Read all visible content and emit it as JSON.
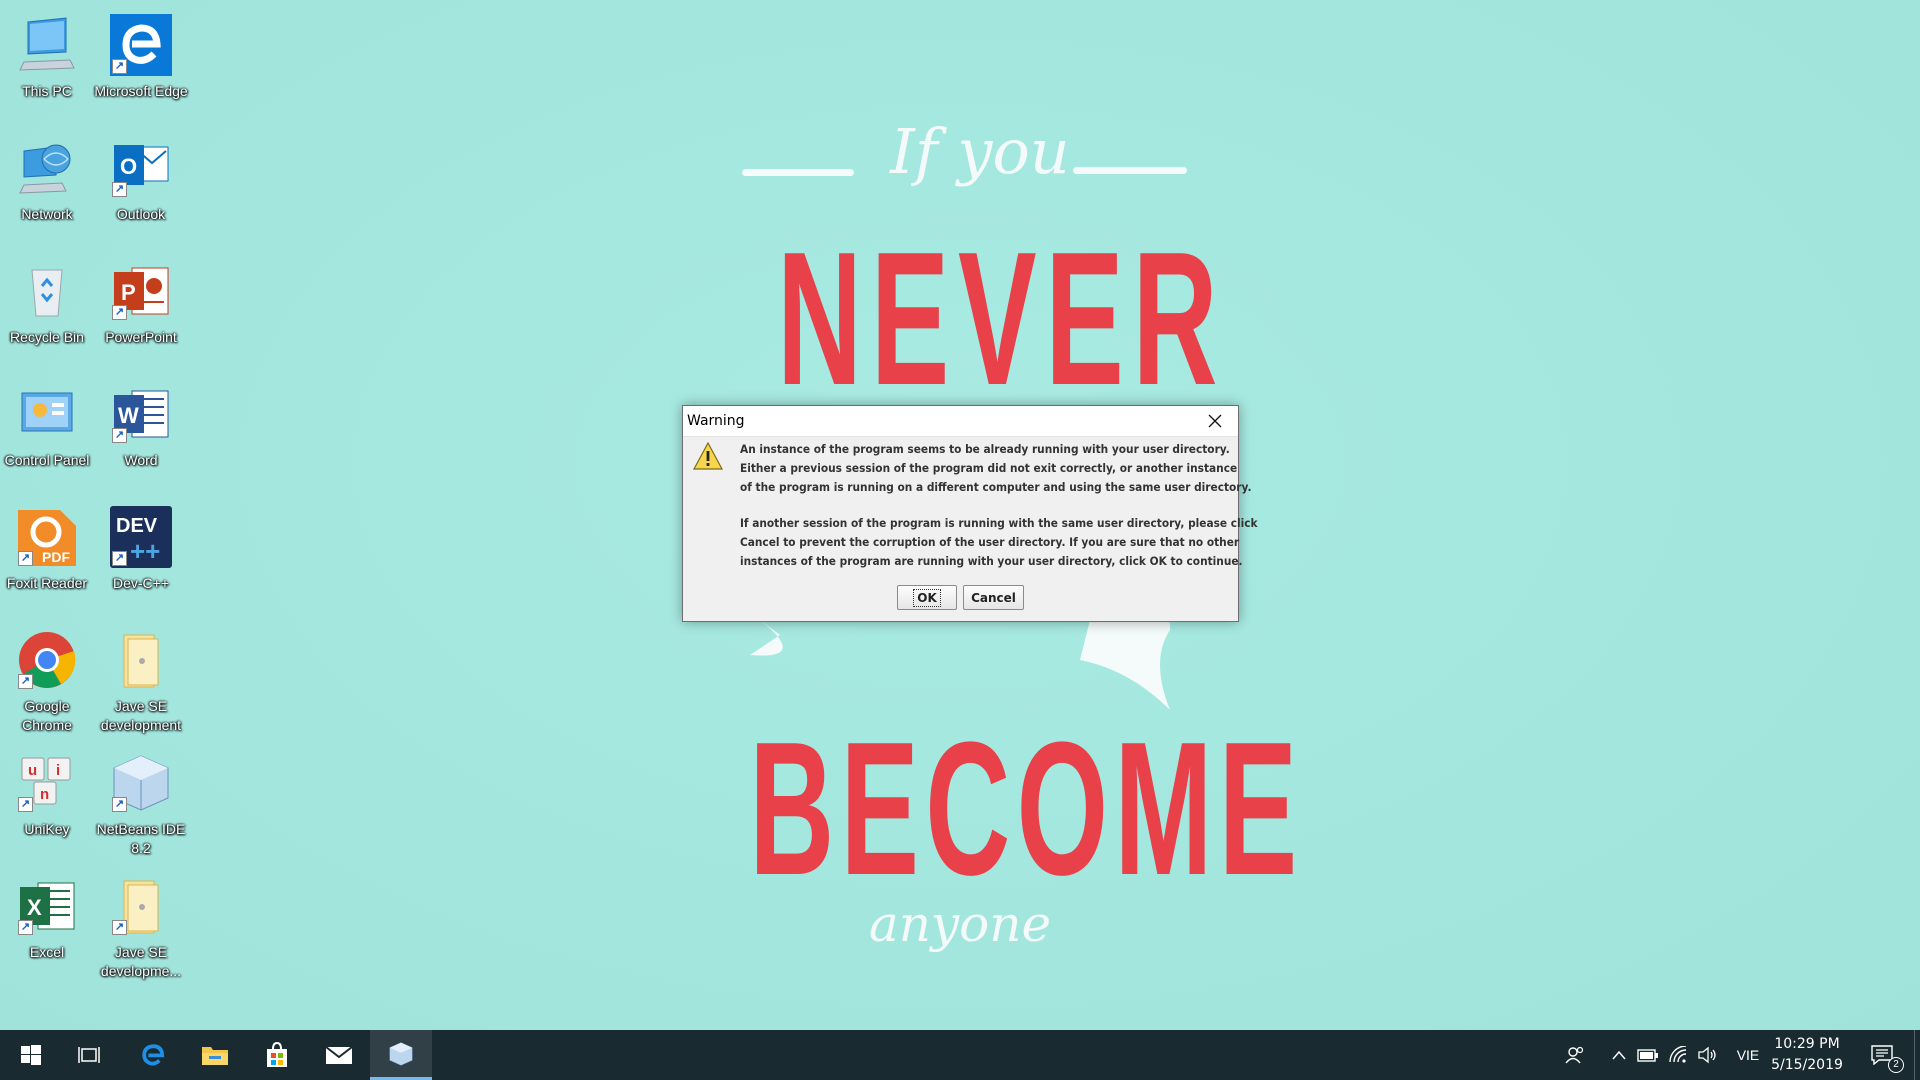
{
  "desktop": {
    "icons": [
      {
        "label": "This PC",
        "icon": "this-pc-icon"
      },
      {
        "label": "Microsoft Edge",
        "icon": "edge-icon"
      },
      {
        "label": "Network",
        "icon": "network-icon"
      },
      {
        "label": "Outlook",
        "icon": "outlook-icon"
      },
      {
        "label": "Recycle Bin",
        "icon": "recycle-bin-icon"
      },
      {
        "label": "PowerPoint",
        "icon": "powerpoint-icon"
      },
      {
        "label": "Control Panel",
        "icon": "control-panel-icon"
      },
      {
        "label": "Word",
        "icon": "word-icon"
      },
      {
        "label": "Foxit Reader",
        "icon": "foxit-reader-icon"
      },
      {
        "label": "Dev-C++",
        "icon": "dev-cpp-icon"
      },
      {
        "label": "Google Chrome",
        "icon": "chrome-icon"
      },
      {
        "label": "Jave SE development",
        "icon": "folder-icon"
      },
      {
        "label": "UniKey",
        "icon": "unikey-icon"
      },
      {
        "label": "NetBeans IDE 8.2",
        "icon": "netbeans-icon"
      },
      {
        "label": "Excel",
        "icon": "excel-icon"
      },
      {
        "label": "Jave SE developme...",
        "icon": "folder-icon"
      }
    ],
    "icon_badges": {
      "pdf": "PDF",
      "dev": "DEV",
      "word": "W",
      "excel": "X",
      "powerpoint": "P",
      "outlook": "O",
      "unikey_u": "u",
      "unikey_i": "i",
      "unikey_n": "n"
    }
  },
  "wallpaper": {
    "line1": "If you",
    "line2": "NEVER",
    "line3": "BECOME",
    "line4": "anyone"
  },
  "dialog": {
    "title": "Warning",
    "message_1": [
      "An instance of the program seems to be already running with your user directory.",
      "Either a previous session of the program did not exit correctly, or another instance",
      "of the program is running on a different computer and using the same user directory."
    ],
    "message_2": [
      "If another session of the program is running with the same user directory, please click",
      "Cancel to prevent the corruption of the user directory. If you are sure that no other",
      "instances of the program are running with your user directory, click OK to continue."
    ],
    "ok_label": "OK",
    "cancel_label": "Cancel"
  },
  "taskbar": {
    "items": [
      "start-icon",
      "task-view-icon",
      "edge-icon",
      "file-explorer-icon",
      "store-icon",
      "mail-icon",
      "netbeans-icon"
    ],
    "active_item": "netbeans-icon",
    "tray": {
      "language": "VIE",
      "time": "10:29 PM",
      "date": "5/15/2019",
      "notification_count": "2"
    }
  },
  "colors": {
    "wallpaper": "#a4e8e0",
    "accent_red": "#e8414a",
    "taskbar": "#1a2a31"
  }
}
